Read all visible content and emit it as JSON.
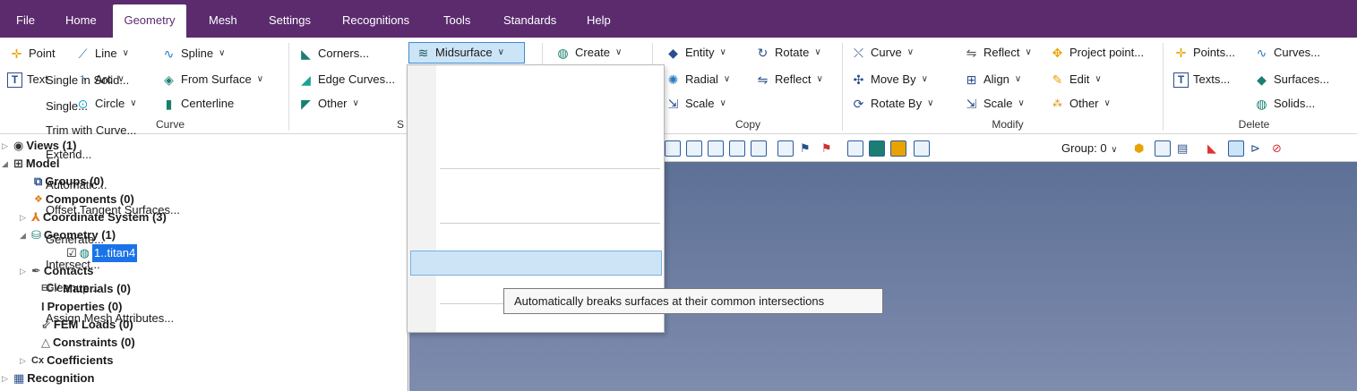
{
  "menu": {
    "tabs": [
      "File",
      "Home",
      "Geometry",
      "Mesh",
      "Settings",
      "Recognitions",
      "Tools",
      "Standards",
      "Help"
    ],
    "active": "Geometry"
  },
  "ribbon": {
    "curve": {
      "point": "Point",
      "text": "Text",
      "line": "Line",
      "arc": "Arc",
      "circle": "Circle",
      "spline": "Spline",
      "from_surface": "From Surface",
      "centerline": "Centerline",
      "group_label": "Curve"
    },
    "surface": {
      "corners": "Corners...",
      "edge_curves": "Edge Curves...",
      "other": "Other",
      "midsurface": "Midsurface",
      "group_label": "S"
    },
    "create": "Create",
    "copy": {
      "entity": "Entity",
      "rotate": "Rotate",
      "radial": "Radial",
      "reflect": "Reflect",
      "scale": "Scale",
      "group_label": "Copy"
    },
    "modify": {
      "curve": "Curve",
      "reflect": "Reflect",
      "project_point": "Project point...",
      "move_by": "Move By",
      "align": "Align",
      "edit": "Edit",
      "rotate_by": "Rotate By",
      "scale": "Scale",
      "other": "Other",
      "group_label": "Modify"
    },
    "delete": {
      "points": "Points...",
      "curves": "Curves...",
      "texts": "Texts...",
      "surfaces": "Surfaces...",
      "solids": "Solids...",
      "group_label": "Delete"
    }
  },
  "view_toolbar": {
    "group_label": "Group: 0"
  },
  "tree": {
    "views": "Views (1)",
    "model": "Model",
    "groups": "Groups (0)",
    "components": "Components (0)",
    "coordinate_system": "Coordinate System (3)",
    "geometry": "Geometry (1)",
    "geometry_item": "1..titan4",
    "contacts": "Contacts",
    "materials": "Materials (0)",
    "properties": "Properties (0)",
    "fem_loads": "FEM Loads (0)",
    "constraints": "Constraints (0)",
    "coefficients": "Coefficients",
    "recognition": "Recognition"
  },
  "dropdown": {
    "items": [
      "Single in Solid...",
      "Single...",
      "Trim with Curve...",
      "Extend...",
      "Automatic...",
      "Offset Tangent Surfaces...",
      "Generate...",
      "Intersect...",
      "Cleanup...",
      "Assign Mesh Attributes..."
    ],
    "highlighted": "Intersect..."
  },
  "tooltip": "Automatically breaks surfaces at their common intersections",
  "colors": {
    "menubar": "#5b2b6e",
    "highlight": "#cde4f6",
    "viewport_top": "#5e7096",
    "viewport_bottom": "#7e8cae"
  }
}
